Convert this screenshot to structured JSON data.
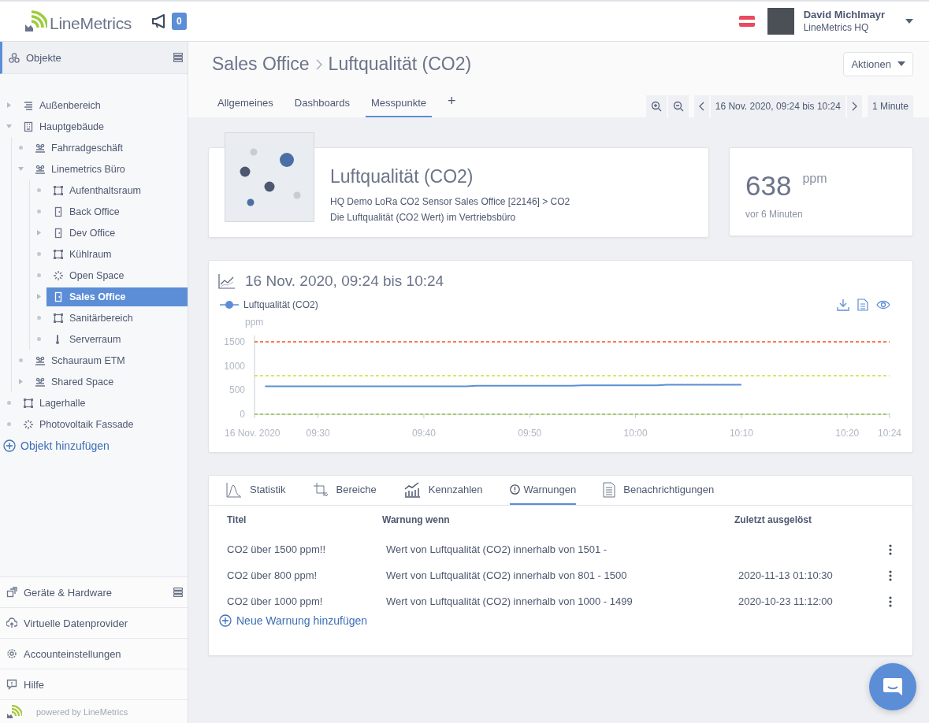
{
  "header": {
    "brand": "LineMetrics",
    "announcements": {
      "count": "0"
    },
    "user": {
      "name": "David Michlmayr",
      "org": "LineMetrics HQ"
    }
  },
  "sidebar": {
    "section_title": "Objekte",
    "tree": [
      {
        "label": "Außenbereich",
        "kind": "area",
        "leaf": false,
        "expanded": false,
        "selected": false
      },
      {
        "label": "Hauptgebäude",
        "kind": "building",
        "leaf": false,
        "expanded": true,
        "selected": false,
        "children": [
          {
            "label": "Fahrradgeschäft",
            "kind": "group",
            "leaf": true,
            "expanded": false,
            "selected": false
          },
          {
            "label": "Linemetrics Büro",
            "kind": "group",
            "leaf": false,
            "expanded": true,
            "selected": false,
            "children": [
              {
                "label": "Aufenthaltsraum",
                "kind": "room",
                "leaf": true,
                "expanded": false,
                "selected": false
              },
              {
                "label": "Back Office",
                "kind": "door",
                "leaf": true,
                "expanded": false,
                "selected": false
              },
              {
                "label": "Dev Office",
                "kind": "door",
                "leaf": false,
                "expanded": false,
                "selected": false
              },
              {
                "label": "Kühlraum",
                "kind": "room",
                "leaf": true,
                "expanded": false,
                "selected": false
              },
              {
                "label": "Open Space",
                "kind": "spread",
                "leaf": true,
                "expanded": false,
                "selected": false
              },
              {
                "label": "Sales Office",
                "kind": "door",
                "leaf": false,
                "expanded": false,
                "selected": true
              },
              {
                "label": "Sanitärbereich",
                "kind": "room",
                "leaf": true,
                "expanded": false,
                "selected": false
              },
              {
                "label": "Serverraum",
                "kind": "thermometer",
                "leaf": true,
                "expanded": false,
                "selected": false
              }
            ]
          },
          {
            "label": "Schauraum ETM",
            "kind": "group",
            "leaf": true,
            "expanded": false,
            "selected": false
          },
          {
            "label": "Shared Space",
            "kind": "group",
            "leaf": false,
            "expanded": false,
            "selected": false
          }
        ]
      },
      {
        "label": "Lagerhalle",
        "kind": "room",
        "leaf": true,
        "expanded": false,
        "selected": false
      },
      {
        "label": "Photovoltaik Fassade",
        "kind": "spread",
        "leaf": true,
        "expanded": false,
        "selected": false
      }
    ],
    "add_object": "Objekt hinzufügen",
    "nav": [
      {
        "label": "Geräte & Hardware",
        "kind": "devices",
        "has_menu": true
      },
      {
        "label": "Virtuelle Datenprovider",
        "kind": "cloud",
        "has_menu": false
      },
      {
        "label": "Accounteinstellungen",
        "kind": "gear",
        "has_menu": false
      },
      {
        "label": "Hilfe",
        "kind": "help",
        "has_menu": false
      }
    ],
    "powered_by": "powered by LineMetrics"
  },
  "page": {
    "breadcrumb": [
      "Sales Office",
      "Luftqualität (CO2)"
    ],
    "actions_label": "Aktionen",
    "tabs": [
      {
        "label": "Allgemeines",
        "selected": false
      },
      {
        "label": "Dashboards",
        "selected": false
      },
      {
        "label": "Messpunkte",
        "selected": true
      }
    ],
    "add_tab": "+",
    "time_range": "16 Nov. 2020, 09:24 bis 10:24",
    "interval": "1 Minute"
  },
  "sensor": {
    "title": "Luftqualität (CO2)",
    "source": "HQ Demo LoRa CO2 Sensor Sales Office [22146] > CO2",
    "description": "Die Luftqualität (CO2 Wert) im Vertriebsbüro",
    "value": "638",
    "unit": "ppm",
    "age": "vor 6 Minuten"
  },
  "chart_card": {
    "title": "16 Nov. 2020, 09:24 bis 10:24",
    "chart_data": {
      "type": "line",
      "ylabel": "ppm",
      "categories": [
        "16 Nov. 2020",
        null,
        null,
        null,
        null,
        null,
        "09:30",
        null,
        null,
        null,
        null,
        null,
        null,
        null,
        null,
        null,
        "09:40",
        null,
        null,
        null,
        null,
        null,
        null,
        null,
        null,
        null,
        "09:50",
        null,
        null,
        null,
        null,
        null,
        null,
        null,
        null,
        null,
        "10:00",
        null,
        null,
        null,
        null,
        null,
        null,
        null,
        null,
        null,
        "10:10",
        null,
        null,
        null,
        null,
        null,
        null,
        null,
        null,
        null,
        "10:20",
        null,
        null,
        null,
        "10:24"
      ],
      "series": [
        {
          "name": "Luftqualität (CO2)",
          "color": "#5b8ed6",
          "values": [
            null,
            580,
            580,
            580,
            580,
            580,
            580,
            580,
            580,
            580,
            580,
            580,
            580,
            580,
            580,
            580,
            580,
            580,
            580,
            580,
            580,
            590,
            590,
            590,
            590,
            590,
            590,
            590,
            590,
            590,
            590,
            600,
            600,
            600,
            600,
            600,
            600,
            600,
            600,
            610,
            610,
            610,
            610,
            610,
            610,
            610,
            610,
            null,
            null,
            null,
            null,
            null,
            null,
            null,
            null,
            null,
            null,
            null,
            null,
            null,
            null
          ]
        }
      ],
      "ylim": [
        0,
        1500
      ],
      "yticks": [
        0,
        500,
        1000,
        1500
      ],
      "ref_lines": [
        {
          "axis": "y",
          "value": 1500,
          "color": "#f4511e"
        },
        {
          "axis": "y",
          "value": 800,
          "color": "#c6e03a"
        },
        {
          "axis": "y",
          "value": 0,
          "color": "#8bc34a"
        }
      ]
    }
  },
  "details": {
    "tabs": [
      {
        "label": "Statistik",
        "kind": "bell-curve",
        "selected": false
      },
      {
        "label": "Bereiche",
        "kind": "crop",
        "selected": false
      },
      {
        "label": "Kennzahlen",
        "kind": "bar-chart",
        "selected": false
      },
      {
        "label": "Warnungen",
        "kind": "alert",
        "selected": true
      },
      {
        "label": "Benachrichtigungen",
        "kind": "document",
        "selected": false
      }
    ],
    "columns": [
      "Titel",
      "Warnung wenn",
      "Zuletzt ausgelöst"
    ],
    "rows": [
      {
        "title": "CO2 über 1500 ppm!!",
        "condition": "Wert von Luftqualität (CO2) innerhalb von 1501 -"
      },
      {
        "title": "CO2 über 800 ppm!",
        "condition": "Wert von Luftqualität (CO2) innerhalb von 801 - 1500",
        "last": "2020-11-13 01:10:30"
      },
      {
        "title": "CO2 über 1000 ppm!",
        "condition": "Wert von Luftqualität (CO2) innerhalb von 1000 - 1499",
        "last": "2020-10-23 11:12:00"
      }
    ],
    "add_label": "Neue Warnung hinzufügen"
  }
}
